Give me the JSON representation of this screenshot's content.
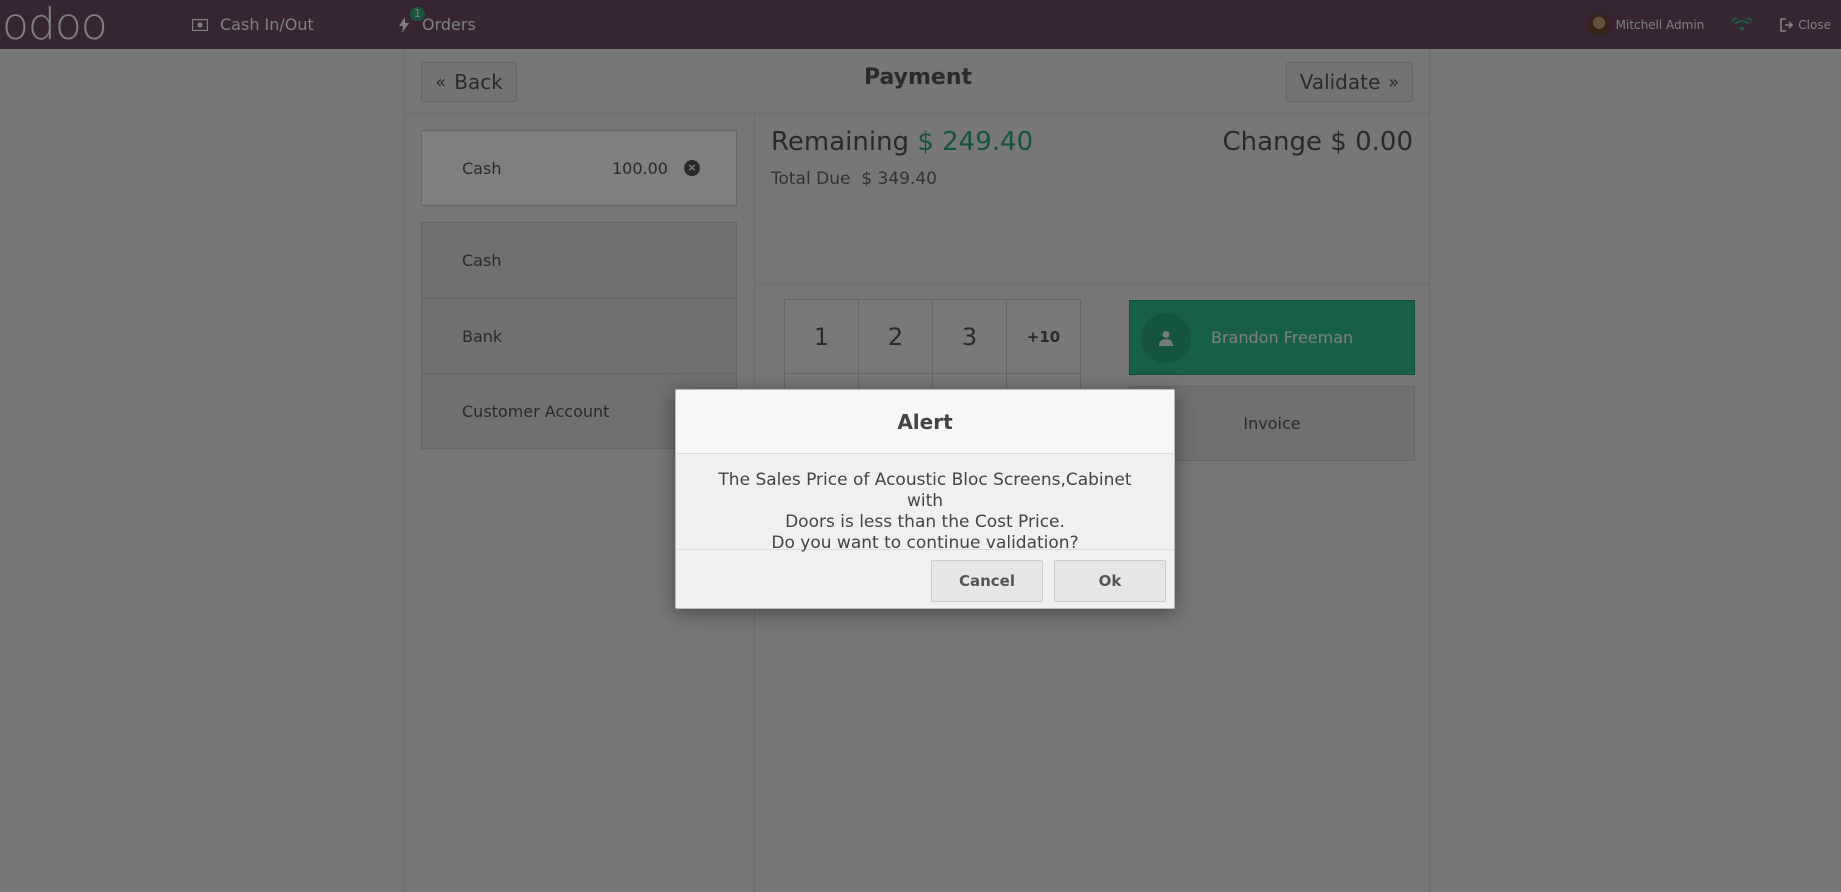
{
  "topbar": {
    "logo": "odoo",
    "cash_label": "Cash In/Out",
    "orders_label": "Orders",
    "orders_badge": "1",
    "user_name": "Mitchell Admin",
    "close_label": "Close"
  },
  "payment": {
    "back_label": "Back",
    "title": "Payment",
    "validate_label": "Validate",
    "line": {
      "method": "Cash",
      "amount": "100.00"
    },
    "methods": [
      "Cash",
      "Bank",
      "Customer Account"
    ],
    "remaining_label": "Remaining",
    "remaining_amount": "$ 249.40",
    "change_label": "Change",
    "change_amount": "$ 0.00",
    "total_due_label": "Total Due",
    "total_due_amount": "$ 349.40",
    "numpad": [
      "1",
      "2",
      "3",
      "+10"
    ],
    "customer": "Brandon Freeman",
    "invoice_label": "Invoice"
  },
  "alert": {
    "title": "Alert",
    "message_line1": "The Sales Price of Acoustic Bloc Screens,Cabinet with",
    "message_line2": "Doors is less than the Cost Price.",
    "message_line3": "Do you want to continue validation?",
    "cancel_label": "Cancel",
    "ok_label": "Ok"
  },
  "colors": {
    "topbar": "#714b67",
    "accent_green": "#2fbf8b",
    "remaining_green": "#2ea87e"
  }
}
